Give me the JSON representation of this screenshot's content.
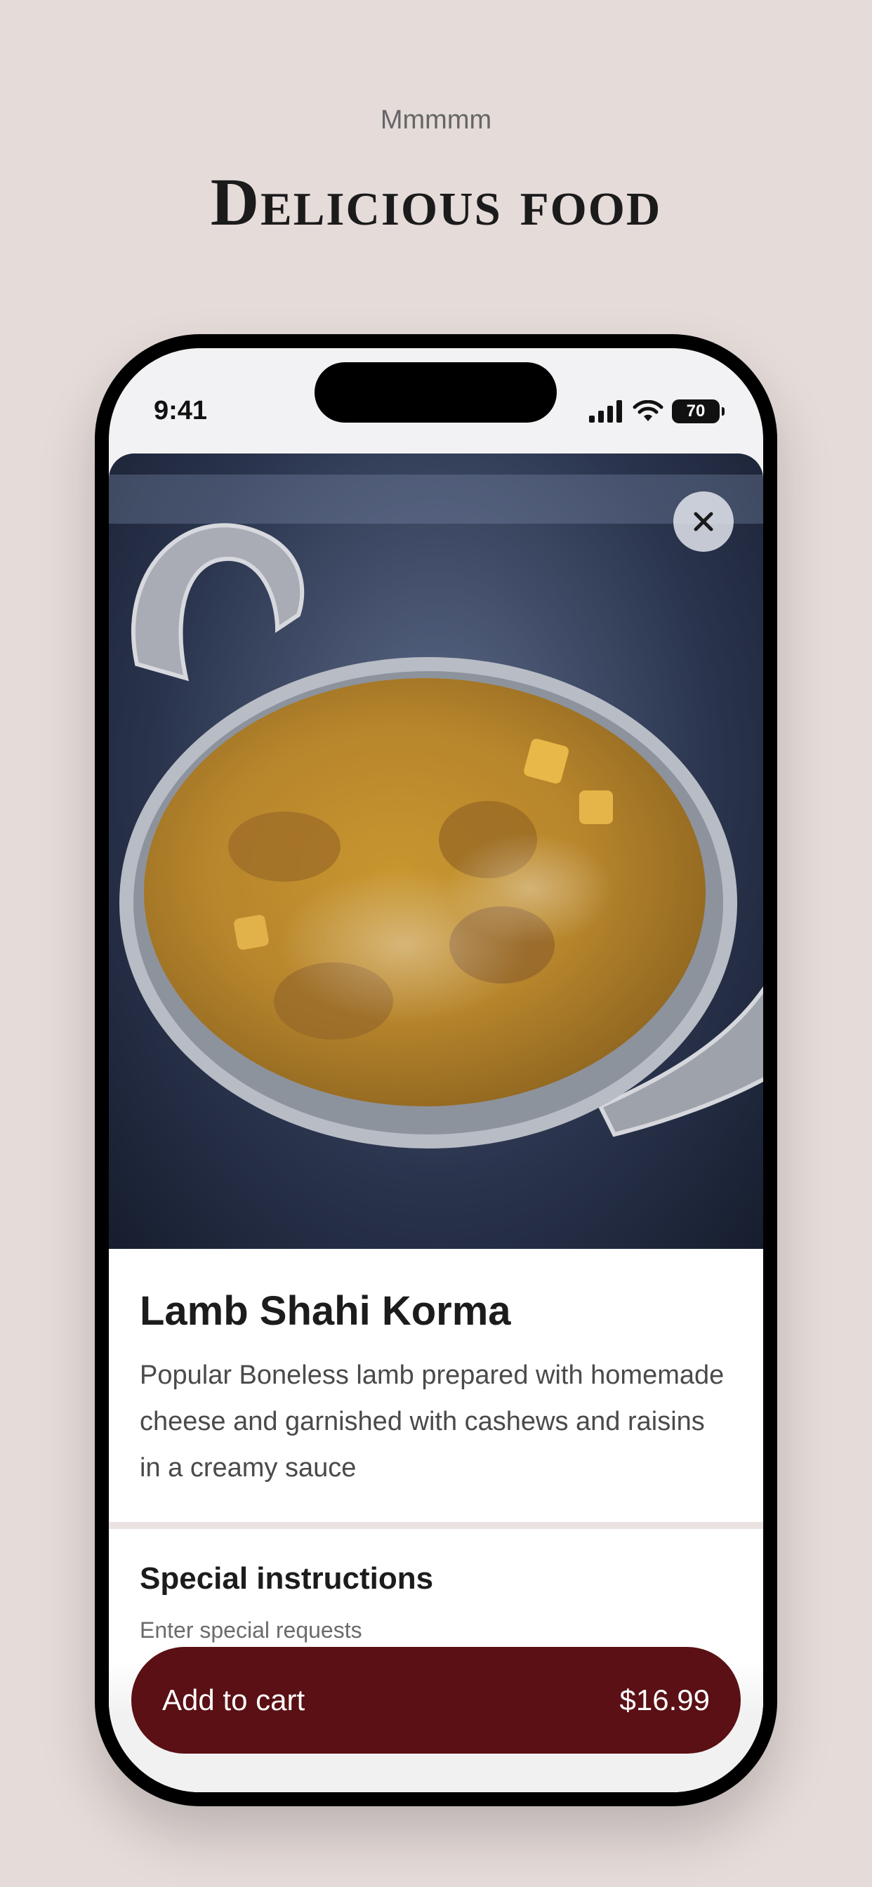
{
  "header": {
    "tagline": "Mmmmm",
    "headline": "Delicious food"
  },
  "status_bar": {
    "time": "9:41",
    "battery": "70",
    "icons": [
      "signal-icon",
      "wifi-icon",
      "battery-icon"
    ]
  },
  "item": {
    "image": "lamb-korma-photo",
    "title": "Lamb Shahi Korma",
    "description": "Popular Boneless lamb prepared with homemade cheese and garnished with cashews and raisins in a creamy sauce"
  },
  "special_instructions": {
    "title": "Special instructions",
    "placeholder": "Enter special requests"
  },
  "cart_button": {
    "label": "Add to cart",
    "price": "$16.99"
  },
  "colors": {
    "background": "#e5dbd9",
    "accent": "#5a1014"
  }
}
